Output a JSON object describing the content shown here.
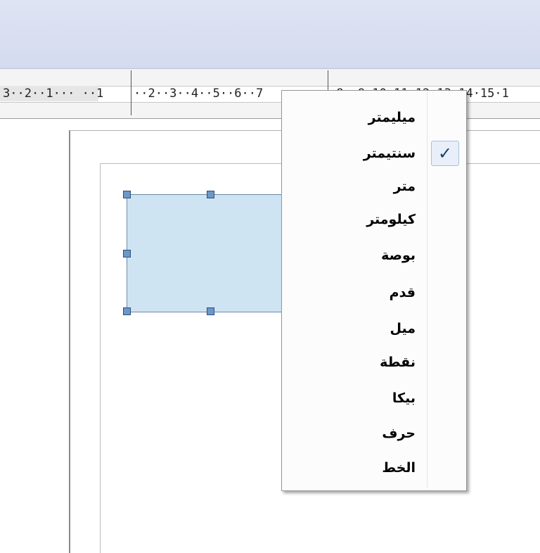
{
  "ruler": {
    "left_text": "3··2··1··· ··1",
    "middle_text": "··2··3··4··5··6··7",
    "right_text": "·8··9·10·11·12·13·14·15·1"
  },
  "unit_menu": {
    "selected": "سنتيمتر",
    "check_glyph": "✓",
    "items": [
      "ميليمتر",
      "سنتيمتر",
      "متر",
      "كيلومتر",
      "بوصة",
      "قدم",
      "ميل",
      "نقطة",
      "بيكا",
      "حرف",
      "الخط"
    ]
  }
}
